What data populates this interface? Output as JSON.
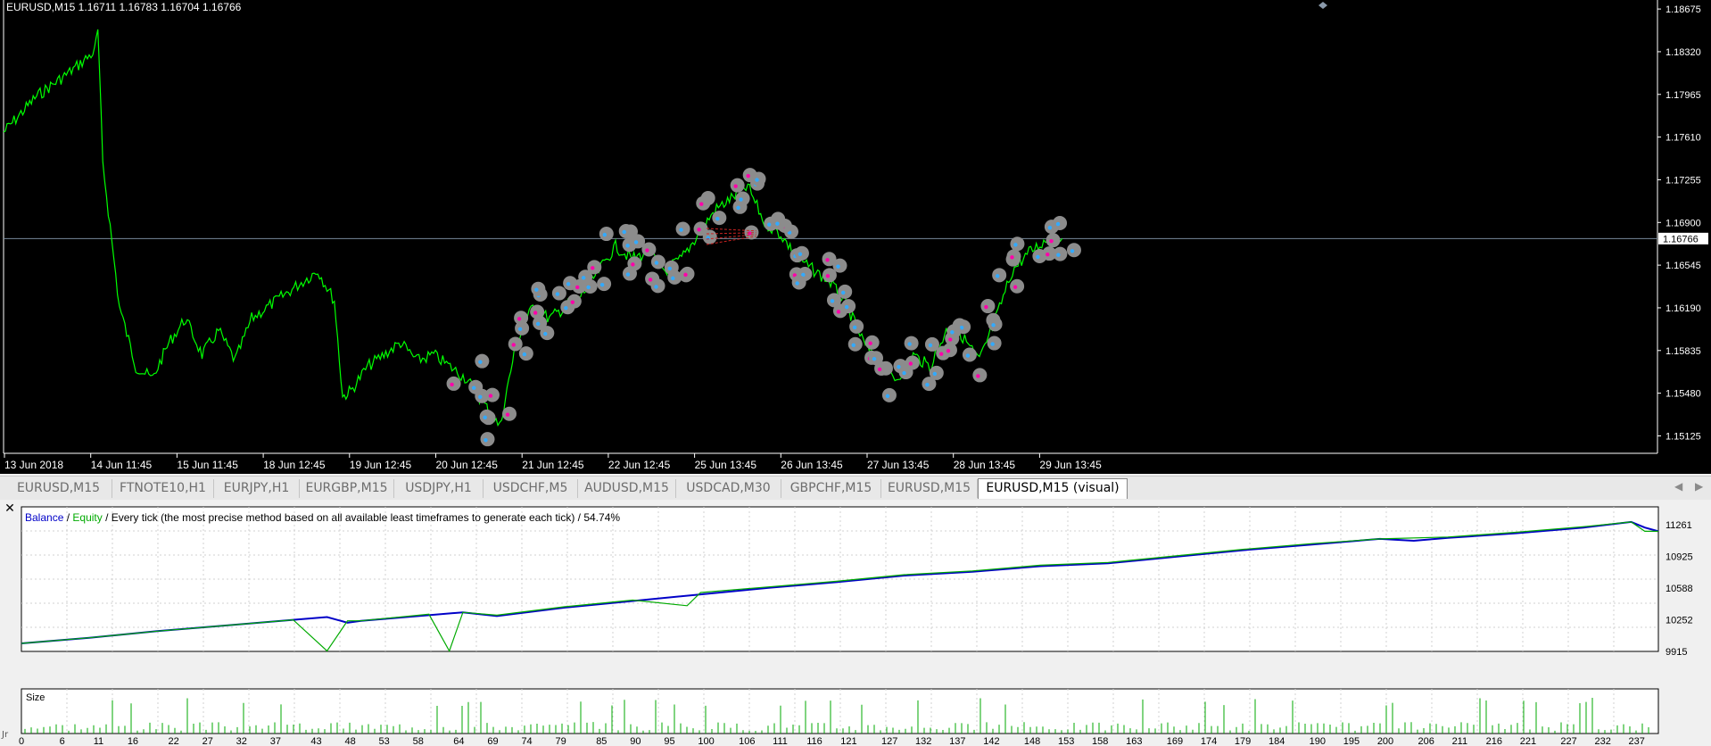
{
  "price_chart": {
    "symbol_info": "EURUSD,M15  1.16711 1.16783 1.16704 1.16766",
    "price_labels": [
      "1.18675",
      "1.18320",
      "1.17965",
      "1.17610",
      "1.17255",
      "1.16900",
      "1.16545",
      "1.16190",
      "1.15835",
      "1.15480",
      "1.15125"
    ],
    "current_price": "1.16766",
    "date_labels": [
      "13 Jun 2018",
      "14 Jun 11:45",
      "15 Jun 11:45",
      "18 Jun 12:45",
      "19 Jun 12:45",
      "20 Jun 12:45",
      "21 Jun 12:45",
      "22 Jun 12:45",
      "25 Jun 13:45",
      "26 Jun 13:45",
      "27 Jun 13:45",
      "28 Jun 13:45",
      "29 Jun 13:45"
    ],
    "colors": {
      "background": "#000000",
      "price_line": "#00ff00",
      "axis_text": "#ffffff",
      "current_line": "#778899"
    }
  },
  "tabs": [
    {
      "label": "EURUSD,M15"
    },
    {
      "label": "FTNOTE10,H1"
    },
    {
      "label": "EURJPY,H1"
    },
    {
      "label": "EURGBP,M15"
    },
    {
      "label": "USDJPY,H1"
    },
    {
      "label": "USDCHF,M5"
    },
    {
      "label": "AUDUSD,M15"
    },
    {
      "label": "USDCAD,M30"
    },
    {
      "label": "GBPCHF,M15"
    },
    {
      "label": "EURUSD,M15"
    },
    {
      "label": "EURUSD,M15 (visual)",
      "active": true
    }
  ],
  "tester_graph": {
    "legend": {
      "balance": "Balance",
      "sep1": " / ",
      "equity": "Equity",
      "rest": " / Every tick (the most precise method based on all available least timeframes to generate each tick) / 54.74%"
    },
    "value_labels": [
      "11261",
      "10925",
      "10588",
      "10252",
      "9915"
    ],
    "size_label": "Size",
    "x_labels": [
      "0",
      "6",
      "11",
      "16",
      "22",
      "27",
      "32",
      "37",
      "43",
      "48",
      "53",
      "58",
      "64",
      "69",
      "74",
      "79",
      "85",
      "90",
      "95",
      "100",
      "106",
      "111",
      "116",
      "121",
      "127",
      "132",
      "137",
      "142",
      "148",
      "153",
      "158",
      "163",
      "169",
      "174",
      "179",
      "184",
      "190",
      "195",
      "200",
      "206",
      "211",
      "216",
      "221",
      "227",
      "232",
      "237"
    ],
    "side_label": "Jr",
    "colors": {
      "balance": "#0000c8",
      "equity": "#00aa00",
      "grid": "#c8c8c8"
    }
  },
  "chart_data": [
    {
      "type": "line",
      "title": "EURUSD,M15",
      "y_range": [
        1.1498,
        1.1875
      ],
      "x_range": [
        0,
        1
      ],
      "series": [
        {
          "x": [
            0,
            0.02,
            0.04,
            0.055,
            0.057,
            0.06,
            0.07,
            0.08,
            0.09,
            0.1,
            0.11,
            0.12,
            0.13,
            0.14,
            0.15,
            0.16,
            0.17,
            0.18,
            0.19,
            0.2,
            0.205,
            0.21,
            0.22,
            0.23,
            0.24,
            0.25,
            0.26,
            0.27,
            0.28,
            0.29,
            0.3,
            0.31,
            0.32,
            0.33,
            0.34,
            0.35,
            0.36,
            0.37,
            0.38,
            0.39,
            0.4,
            0.41,
            0.42,
            0.43,
            0.44,
            0.45,
            0.46,
            0.47,
            0.48,
            0.49,
            0.5,
            0.51,
            0.52,
            0.53,
            0.54,
            0.55,
            0.56,
            0.57,
            0.58,
            0.59,
            0.6,
            0.61,
            0.62,
            0.63,
            0.64
          ],
          "y": [
            1.1765,
            1.1795,
            1.1815,
            1.1832,
            1.185,
            1.174,
            1.162,
            1.157,
            1.156,
            1.159,
            1.161,
            1.158,
            1.16,
            1.1575,
            1.161,
            1.162,
            1.163,
            1.164,
            1.165,
            1.1625,
            1.1545,
            1.155,
            1.157,
            1.158,
            1.159,
            1.1575,
            1.158,
            1.157,
            1.156,
            1.154,
            1.152,
            1.159,
            1.162,
            1.161,
            1.162,
            1.163,
            1.165,
            1.167,
            1.166,
            1.1665,
            1.165,
            1.166,
            1.168,
            1.17,
            1.171,
            1.172,
            1.169,
            1.168,
            1.166,
            1.165,
            1.164,
            1.162,
            1.159,
            1.157,
            1.156,
            1.158,
            1.157,
            1.16,
            1.1595,
            1.1575,
            1.161,
            1.165,
            1.1665,
            1.1675,
            1.16766
          ]
        }
      ]
    },
    {
      "type": "line",
      "title": "Balance / Equity",
      "y_range": [
        9915,
        11450
      ],
      "x_range": [
        0,
        241
      ],
      "series": [
        {
          "name": "Balance",
          "x": [
            0,
            10,
            20,
            30,
            40,
            45,
            48,
            50,
            60,
            65,
            70,
            80,
            90,
            100,
            110,
            120,
            130,
            140,
            150,
            160,
            170,
            180,
            190,
            200,
            205,
            210,
            220,
            230,
            237,
            239,
            241
          ],
          "y": [
            10000,
            10060,
            10130,
            10190,
            10250,
            10280,
            10220,
            10240,
            10300,
            10330,
            10290,
            10380,
            10450,
            10520,
            10590,
            10650,
            10720,
            10760,
            10820,
            10850,
            10920,
            10990,
            11050,
            11110,
            11090,
            11120,
            11170,
            11230,
            11290,
            11230,
            11190
          ]
        },
        {
          "name": "Equity",
          "x": [
            0,
            10,
            20,
            30,
            40,
            45,
            48,
            50,
            60,
            63,
            65,
            70,
            80,
            90,
            98,
            100,
            110,
            120,
            130,
            140,
            150,
            160,
            170,
            180,
            190,
            200,
            210,
            220,
            230,
            237,
            239,
            241
          ],
          "y": [
            10000,
            10060,
            10130,
            10190,
            10250,
            9920,
            10240,
            10240,
            10310,
            9920,
            10330,
            10300,
            10390,
            10460,
            10400,
            10540,
            10600,
            10660,
            10730,
            10770,
            10830,
            10860,
            10930,
            11000,
            11060,
            11110,
            11130,
            11180,
            11240,
            11290,
            11190,
            11190
          ]
        }
      ]
    }
  ]
}
